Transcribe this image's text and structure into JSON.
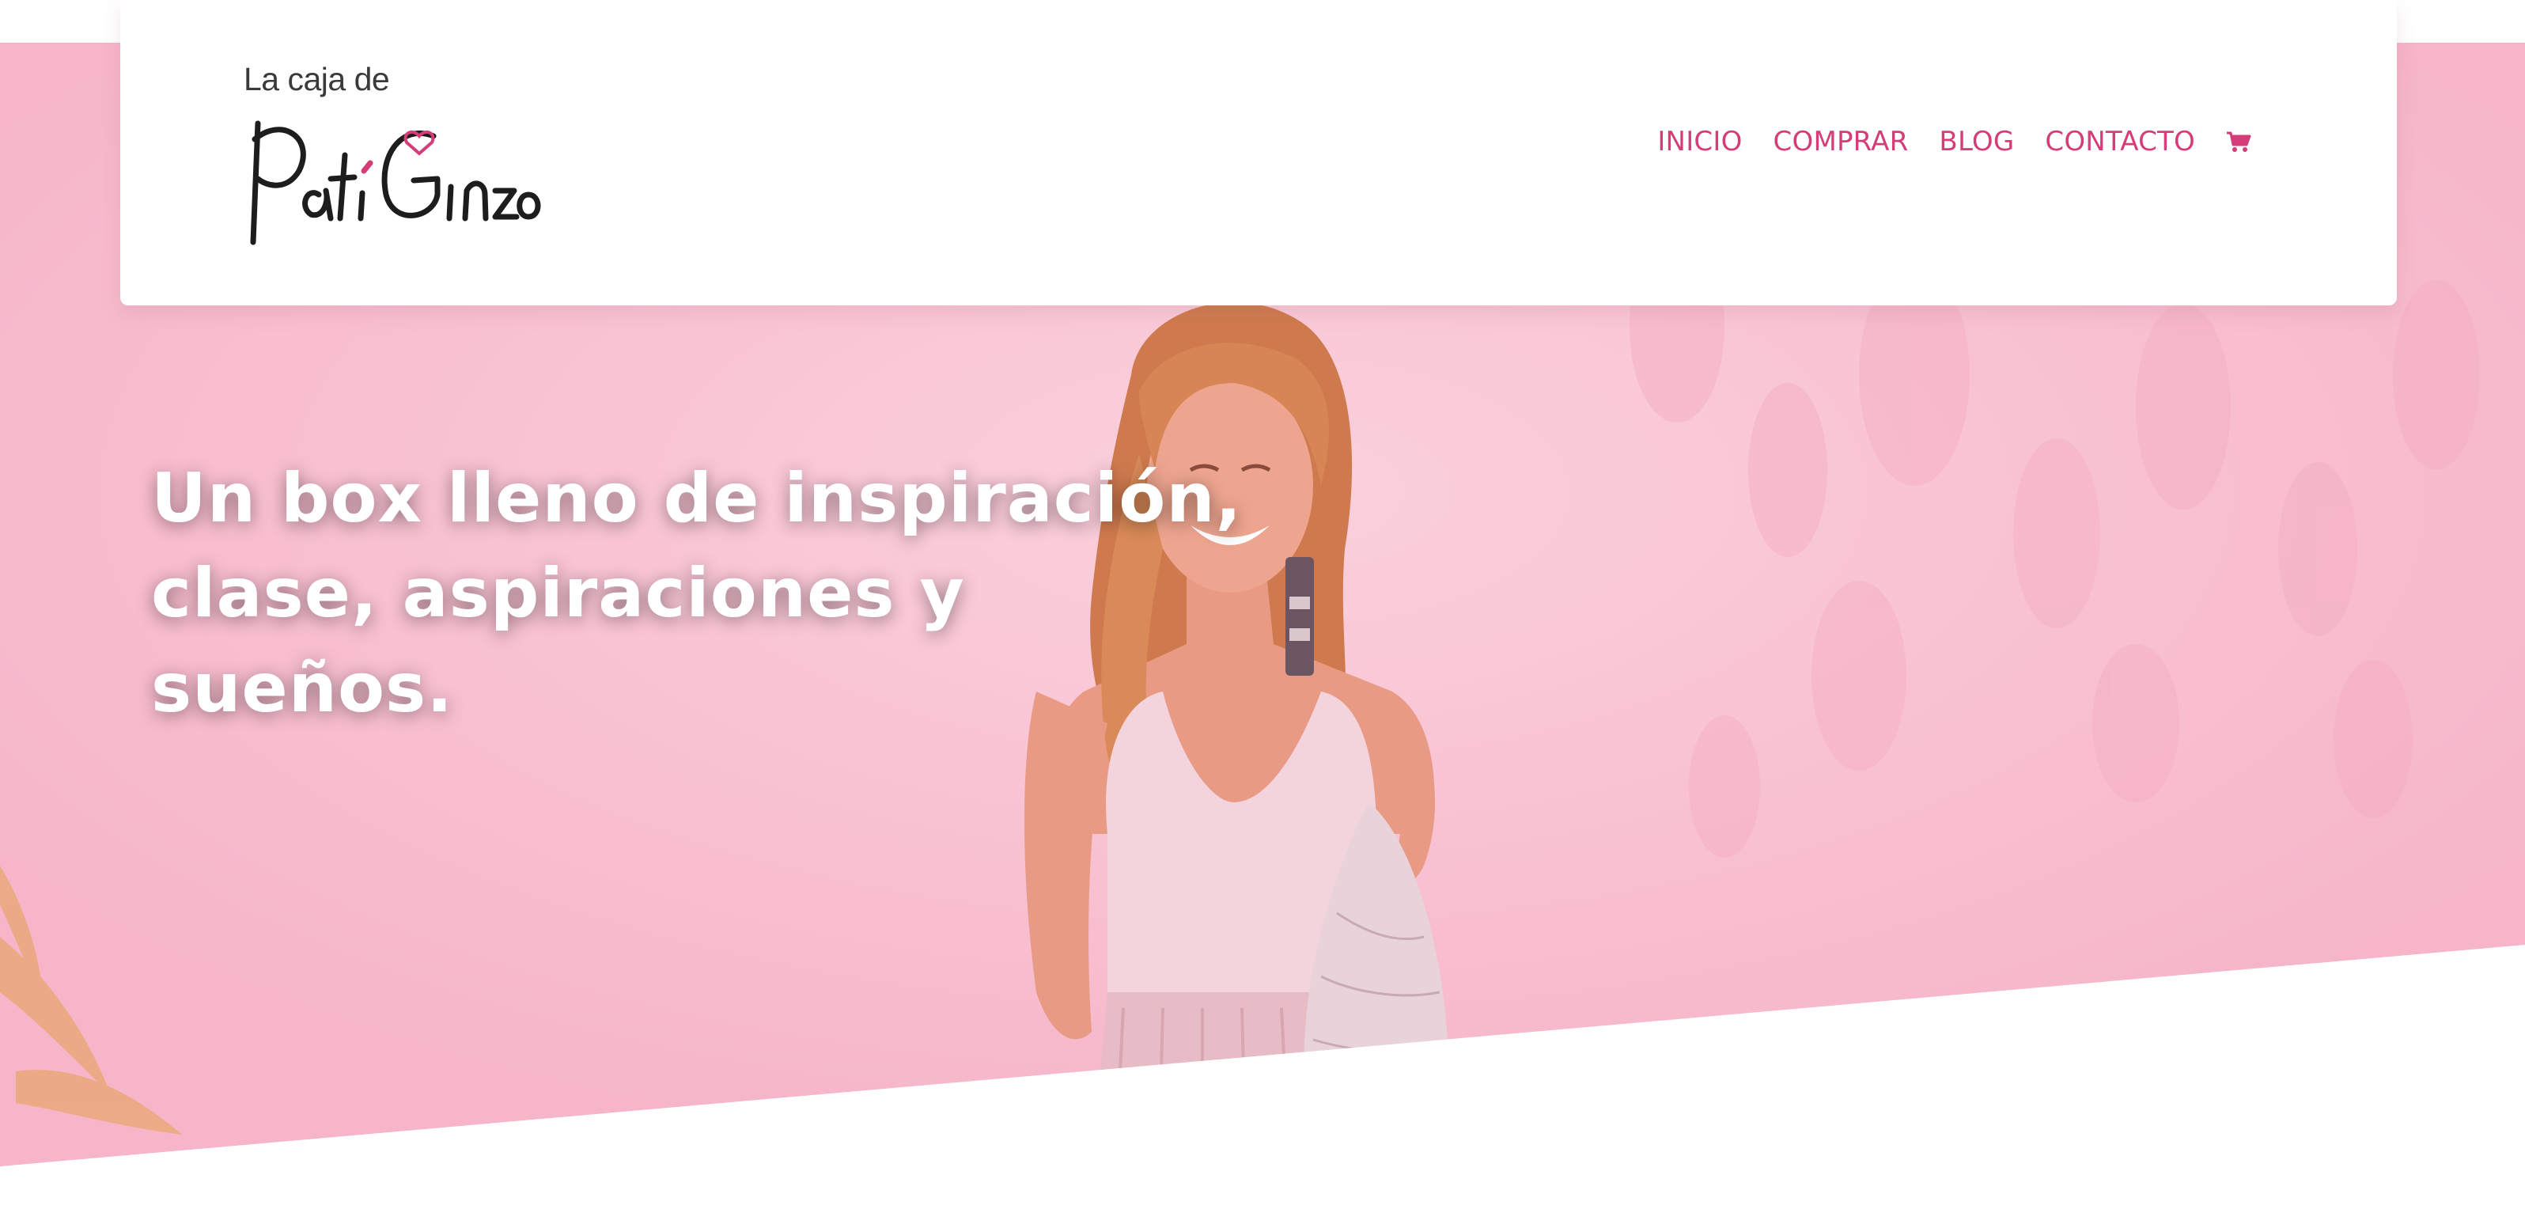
{
  "brand": {
    "subtitle": "La caja de",
    "name": "Pati Ginzo"
  },
  "nav": {
    "items": [
      {
        "label": "INICIO"
      },
      {
        "label": "COMPRAR"
      },
      {
        "label": "BLOG"
      },
      {
        "label": "CONTACTO"
      }
    ],
    "cart_icon": "shopping-cart-icon"
  },
  "hero": {
    "headline_lines": [
      "Un box lleno de inspiración,",
      "clase, aspiraciones y",
      "sueños."
    ]
  },
  "colors": {
    "accent": "#d43d78",
    "hero_overlay": "#f8bfd1",
    "header_bg": "#ffffff",
    "headline_text": "#ffffff"
  }
}
